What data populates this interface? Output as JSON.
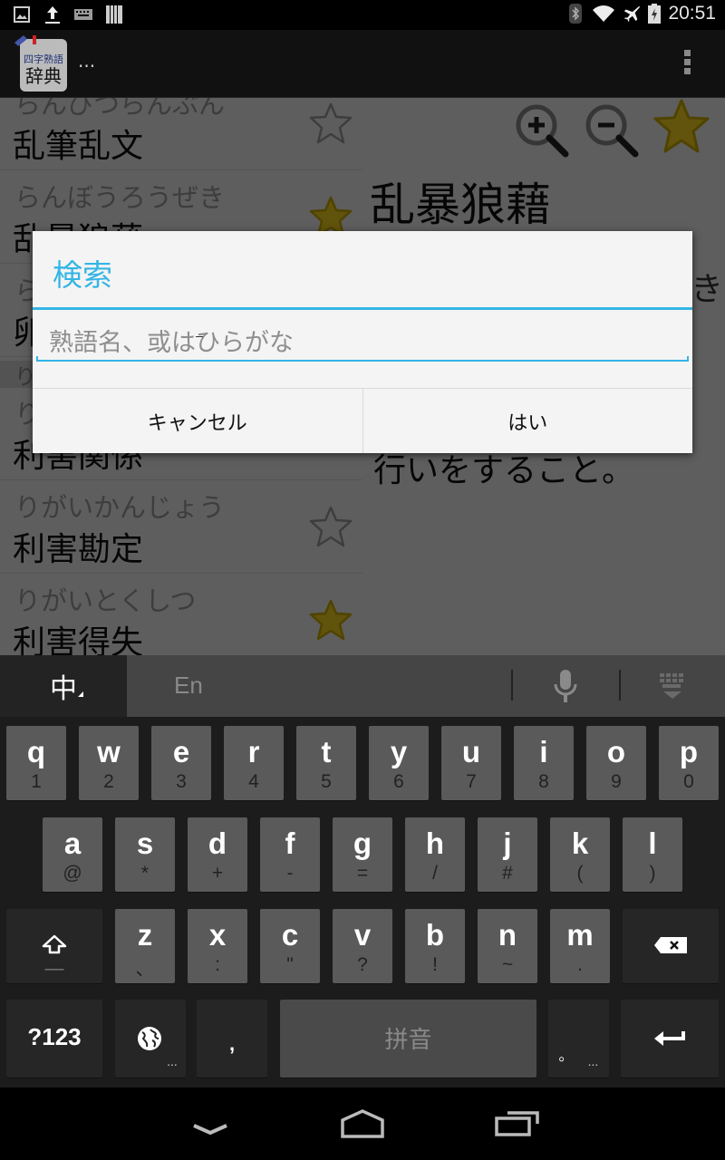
{
  "status_bar": {
    "left_icons": [
      "image-icon",
      "upload-icon",
      "keyboard-icon",
      "barcode-icon"
    ],
    "right_icons": [
      "bluetooth-icon",
      "wifi-icon",
      "airplane-icon",
      "battery-charging-icon"
    ],
    "time": "20:51"
  },
  "action_bar": {
    "app_icon_text_top": "四字熟語",
    "app_icon_text_bottom": "辞典",
    "title": "..."
  },
  "list": {
    "rows": [
      {
        "kana": "らんぴつらんぶん",
        "kanji": "乱筆乱文",
        "favorite": false
      },
      {
        "kana": "らんぼうろうぜき",
        "kanji": "乱暴狼藉",
        "favorite": true
      },
      {
        "kana": "ら",
        "kanji": "卵",
        "favorite": false
      },
      {
        "kana": "り",
        "kanji": "",
        "favorite": false,
        "section_header": true
      },
      {
        "kana": "り",
        "kanji": "利害関係",
        "favorite": false
      },
      {
        "kana": "りがいかんじょう",
        "kanji": "利害勘定",
        "favorite": false
      },
      {
        "kana": "りがいとくしつ",
        "kanji": "利害得失",
        "favorite": true
      }
    ]
  },
  "detail": {
    "word": "乱暴狼藉",
    "description_tail": "行いをすること。",
    "description_right_fragment": "き",
    "favorite": true
  },
  "dialog": {
    "title": "検索",
    "input_value": "",
    "input_placeholder": "熟語名、或はひらがな",
    "cancel_label": "キャンセル",
    "ok_label": "はい",
    "accent_color": "#33b5e5"
  },
  "keyboard": {
    "lang_label": "中",
    "alt_lang_label": "En",
    "rows": [
      [
        {
          "m": "q",
          "s": "1"
        },
        {
          "m": "w",
          "s": "2"
        },
        {
          "m": "e",
          "s": "3"
        },
        {
          "m": "r",
          "s": "4"
        },
        {
          "m": "t",
          "s": "5"
        },
        {
          "m": "y",
          "s": "6"
        },
        {
          "m": "u",
          "s": "7"
        },
        {
          "m": "i",
          "s": "8"
        },
        {
          "m": "o",
          "s": "9"
        },
        {
          "m": "p",
          "s": "0"
        }
      ],
      [
        {
          "m": "a",
          "s": "@"
        },
        {
          "m": "s",
          "s": "*"
        },
        {
          "m": "d",
          "s": "+"
        },
        {
          "m": "f",
          "s": "-"
        },
        {
          "m": "g",
          "s": "="
        },
        {
          "m": "h",
          "s": "/"
        },
        {
          "m": "j",
          "s": "#"
        },
        {
          "m": "k",
          "s": "("
        },
        {
          "m": "l",
          "s": ")"
        }
      ],
      [
        {
          "m": "z",
          "s": "、"
        },
        {
          "m": "x",
          "s": ":"
        },
        {
          "m": "c",
          "s": "\""
        },
        {
          "m": "v",
          "s": "?"
        },
        {
          "m": "b",
          "s": "!"
        },
        {
          "m": "n",
          "s": "~"
        },
        {
          "m": "m",
          "s": "."
        }
      ]
    ],
    "symbols_label": "?123",
    "comma_label": ",",
    "space_label": "拼音",
    "period_label": "。",
    "more_label": "...",
    "shift_sub": "—"
  },
  "nav_bar": {
    "buttons": [
      "back-icon",
      "home-icon",
      "recents-icon"
    ]
  }
}
